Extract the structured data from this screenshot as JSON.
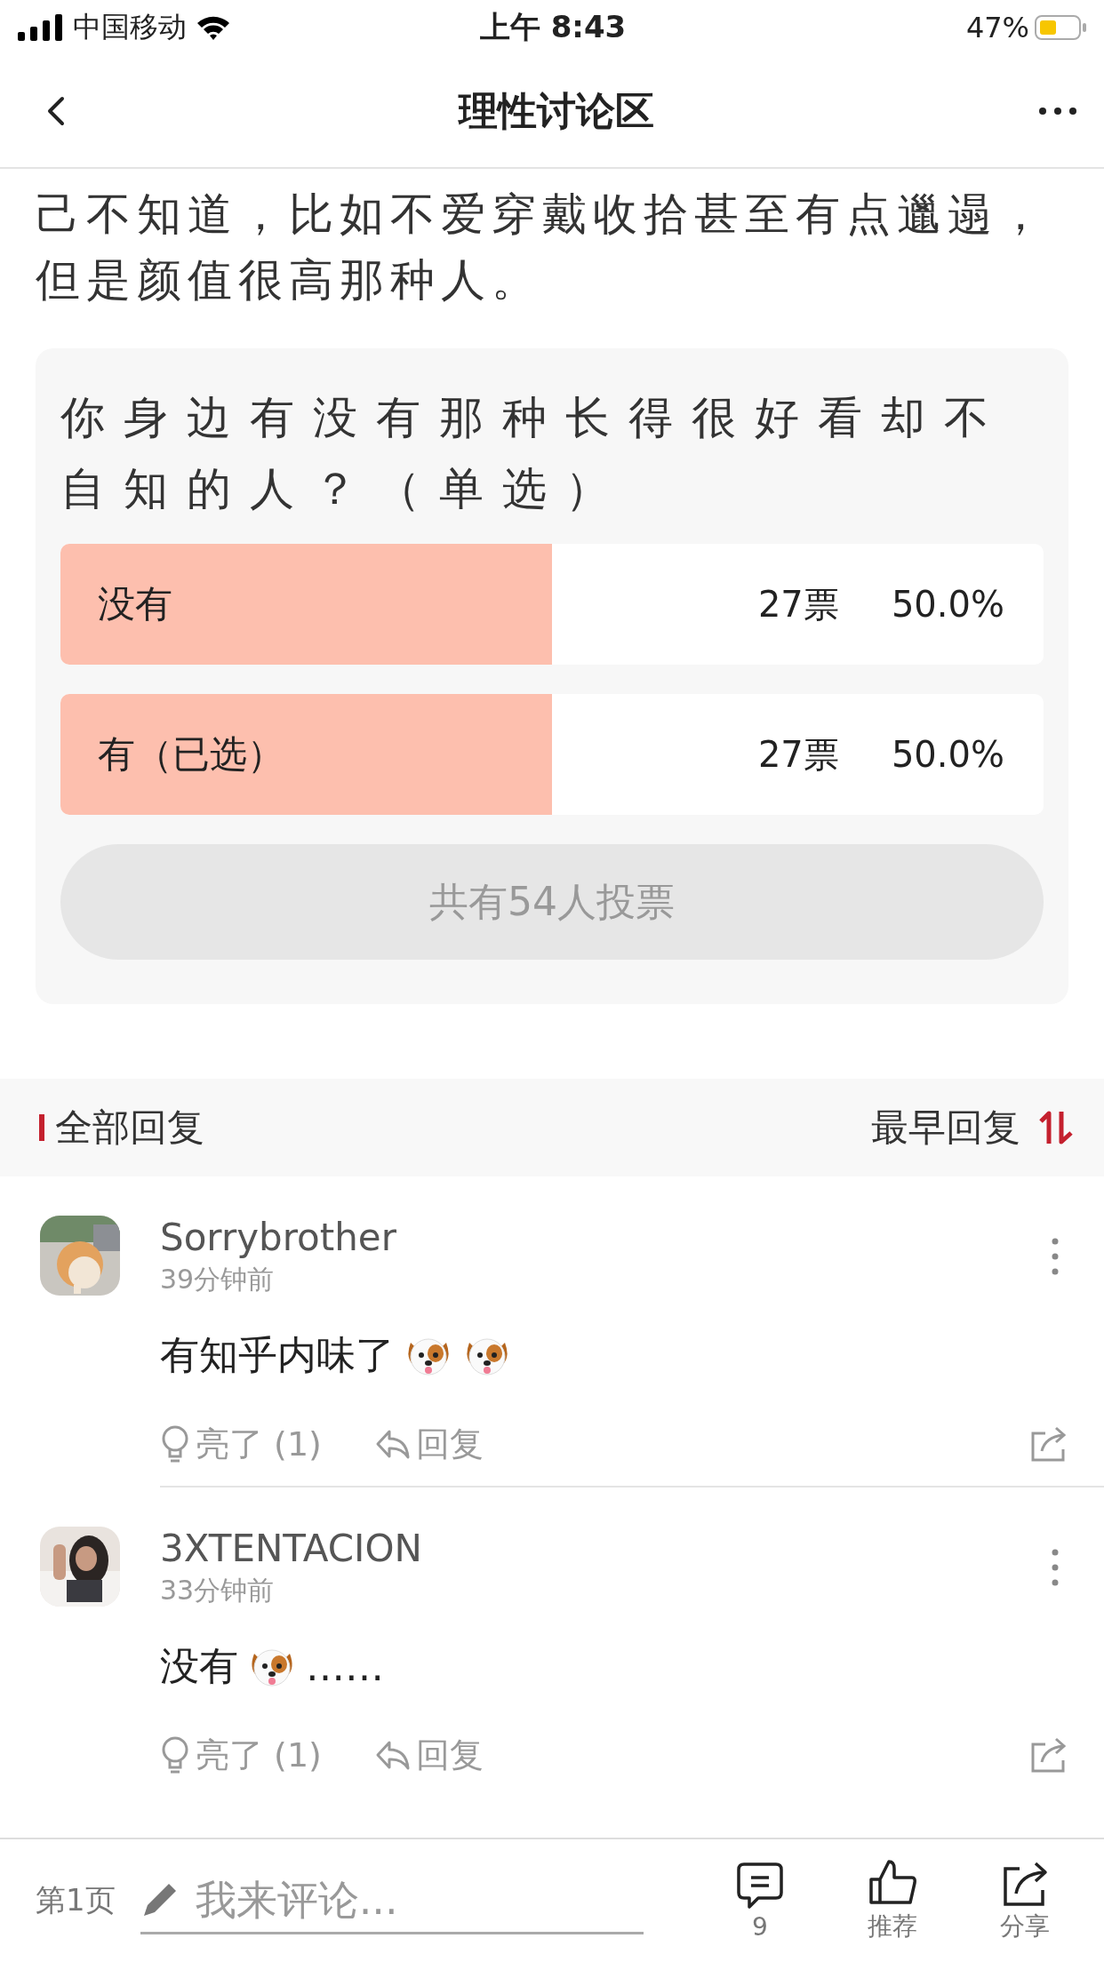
{
  "status_bar": {
    "carrier": "中国移动",
    "time": "上午 8:43",
    "battery": "47%"
  },
  "nav": {
    "title": "理性讨论区"
  },
  "post": {
    "text_lines": [
      "己不知道，比如不爱穿戴收拾甚至有点邋遢，",
      "但是颜值很高那种人。"
    ]
  },
  "poll": {
    "question": "你身边有没有那种长得很好看却不自知的人？（单选）",
    "options": [
      {
        "label": "没有",
        "votes": "27票",
        "percent": "50.0%",
        "level": 0.5
      },
      {
        "label": "有（已选）",
        "votes": "27票",
        "percent": "50.0%",
        "level": 0.5
      }
    ],
    "total": "共有54人投票"
  },
  "replies_header": {
    "title": "全部回复",
    "sort": "最早回复"
  },
  "comments": [
    {
      "author": "Sorrybrother",
      "time": "39分钟前",
      "content": [
        {
          "kind": "text",
          "text": "有知乎内味了"
        },
        {
          "kind": "emoji"
        },
        {
          "kind": "emoji"
        }
      ],
      "light": "亮了 (1)",
      "reply": "回复"
    },
    {
      "author": "3XTENTACION",
      "time": "33分钟前",
      "content": [
        {
          "kind": "text",
          "text": "没有"
        },
        {
          "kind": "emoji"
        },
        {
          "kind": "text",
          "text": "……"
        }
      ],
      "light": "亮了 (1)",
      "reply": "回复"
    }
  ],
  "bottom_bar": {
    "page": "第1页",
    "placeholder": "我来评论...",
    "comment_count": "9",
    "recommend": "推荐",
    "share": "分享"
  }
}
